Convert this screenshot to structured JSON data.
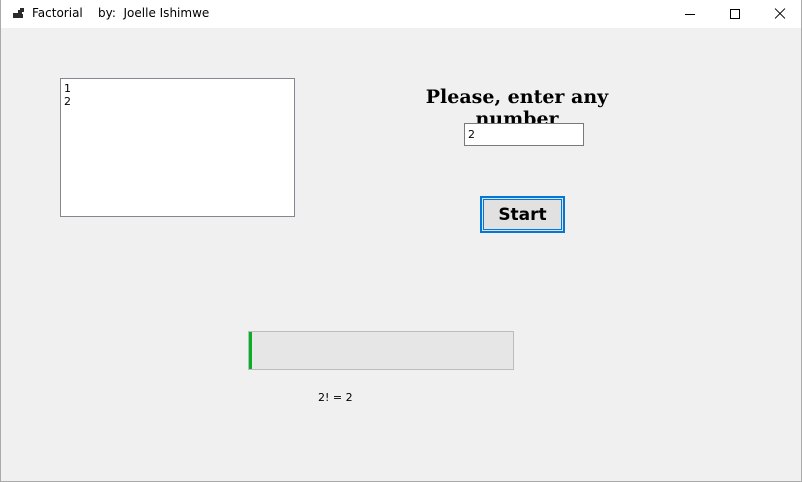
{
  "window": {
    "title": "Factorial",
    "author": "by:  Joelle Ishimwe",
    "icons": {
      "app": "app-icon",
      "minimize": "minimize-icon",
      "maximize": "maximize-icon",
      "close": "close-icon"
    }
  },
  "list": {
    "items": [
      "1",
      "2"
    ]
  },
  "prompt": {
    "label": "Please, enter any number"
  },
  "input": {
    "value": "2"
  },
  "start_button": {
    "label": "Start"
  },
  "progress": {
    "value_percent": 1,
    "fill_color": "#06b025"
  },
  "result": {
    "text": "2! = 2"
  },
  "colors": {
    "accent": "#0078d7",
    "background": "#f0f0f0"
  }
}
